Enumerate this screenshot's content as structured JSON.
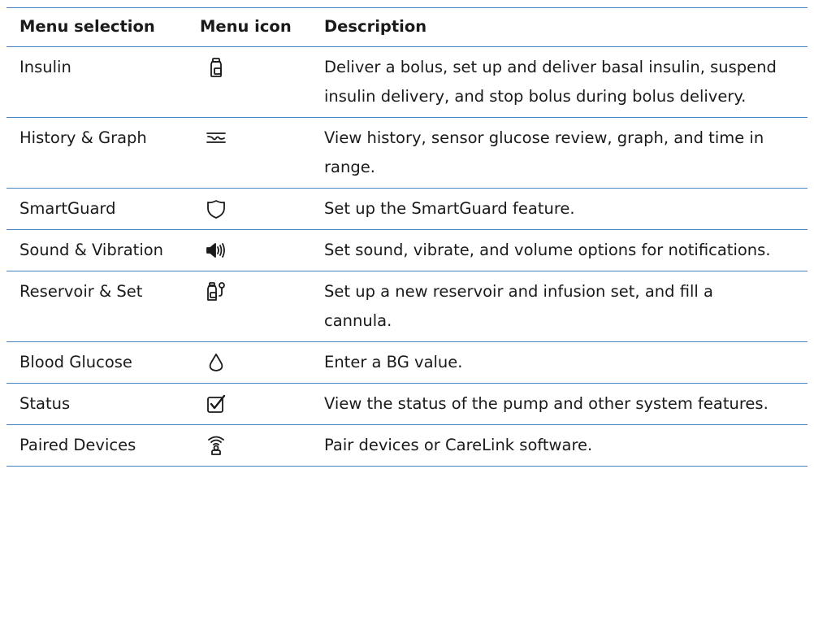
{
  "header": {
    "col1": "Menu selection",
    "col2": "Menu icon",
    "col3": "Description"
  },
  "rows": [
    {
      "selection": "Insulin",
      "icon": "insulin-vial-icon",
      "description": "Deliver a bolus, set up and deliver basal insulin, suspend insulin delivery, and stop bolus during bolus delivery."
    },
    {
      "selection": "History & Graph",
      "icon": "history-graph-icon",
      "description": "View history, sensor glucose review, graph, and time in range."
    },
    {
      "selection": "SmartGuard",
      "icon": "shield-icon",
      "description": "Set up the SmartGuard feature."
    },
    {
      "selection": "Sound & Vibration",
      "icon": "speaker-icon",
      "description": "Set sound, vibrate, and volume options for notifications."
    },
    {
      "selection": "Reservoir & Set",
      "icon": "reservoir-set-icon",
      "description": "Set up a new reservoir and infusion set, and fill a cannula."
    },
    {
      "selection": "Blood Glucose",
      "icon": "blood-drop-icon",
      "description": "Enter a BG value."
    },
    {
      "selection": "Status",
      "icon": "checkbox-icon",
      "description": "View the status of the pump and other system features."
    },
    {
      "selection": "Paired Devices",
      "icon": "paired-devices-icon",
      "description": "Pair devices or CareLink software."
    }
  ],
  "colors": {
    "rule": "#4a86c5",
    "text": "#1a1a1a"
  }
}
